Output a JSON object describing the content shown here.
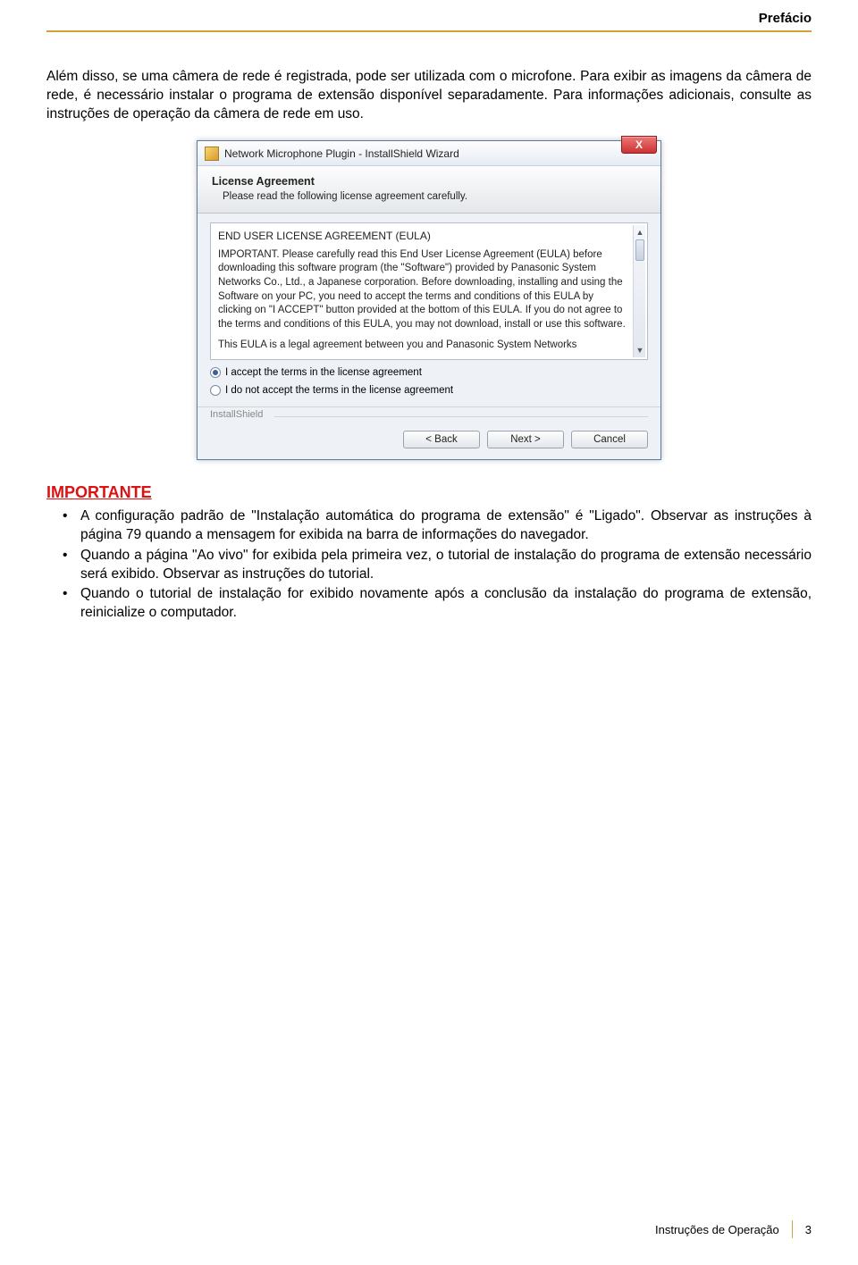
{
  "header": {
    "section": "Prefácio"
  },
  "intro": "Além disso, se uma câmera de rede é registrada, pode ser utilizada com o microfone. Para exibir as imagens da câmera de rede, é necessário instalar o programa de extensão disponível separadamente. Para informações adicionais, consulte as instruções de operação da câmera de rede em uso.",
  "dialog": {
    "title": "Network Microphone Plugin - InstallShield Wizard",
    "close_glyph": "X",
    "banner_title": "License Agreement",
    "banner_sub": "Please read the following license agreement carefully.",
    "eula_heading": "END USER LICENSE AGREEMENT (EULA)",
    "eula_body": "IMPORTANT.  Please carefully read this End User License Agreement (EULA) before downloading this software program (the \"Software\") provided by Panasonic System Networks Co., Ltd., a Japanese corporation.  Before downloading, installing and using the Software on your PC, you need to accept the terms and conditions of this EULA by clicking on \"I ACCEPT\" button provided at the bottom of this EULA.  If you do not agree to the terms and conditions of this EULA, you may not download, install or use this software.",
    "eula_tail": "This EULA is a legal agreement between you and Panasonic System Networks",
    "radio_accept": "I accept the terms in the license agreement",
    "radio_reject": "I do not accept the terms in the license agreement",
    "brand": "InstallShield",
    "btn_back": "< Back",
    "btn_next": "Next >",
    "btn_cancel": "Cancel"
  },
  "important": {
    "heading": "IMPORTANTE",
    "items": [
      "A configuração padrão de \"Instalação automática do programa de extensão\" é \"Ligado\". Observar as instruções à página 79 quando a mensagem for exibida na barra de informações do navegador.",
      "Quando a página \"Ao vivo\" for exibida pela primeira vez, o tutorial de instalação do programa de extensão necessário será exibido. Observar as instruções do tutorial.",
      "Quando o tutorial de instalação for exibido novamente após a conclusão da instalação do programa de extensão, reinicialize o computador."
    ]
  },
  "footer": {
    "label": "Instruções de Operação",
    "page": "3"
  }
}
